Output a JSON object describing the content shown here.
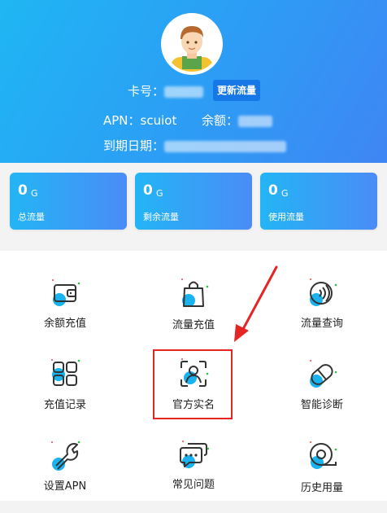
{
  "profile": {
    "card_label": "卡号：",
    "update_button": "更新流量",
    "apn_label": "APN：",
    "apn_value": "scuiot",
    "balance_label": "余额：",
    "expiry_label": "到期日期："
  },
  "stats": [
    {
      "value": "0",
      "unit": "G",
      "label": "总流量"
    },
    {
      "value": "0",
      "unit": "G",
      "label": "剩余流量"
    },
    {
      "value": "0",
      "unit": "G",
      "label": "使用流量"
    }
  ],
  "menu": [
    {
      "label": "余额充值",
      "icon": "wallet-icon"
    },
    {
      "label": "流量充值",
      "icon": "shopping-bag-icon"
    },
    {
      "label": "流量查询",
      "icon": "signal-search-icon"
    },
    {
      "label": "充值记录",
      "icon": "grid-icon"
    },
    {
      "label": "官方实名",
      "icon": "face-scan-icon"
    },
    {
      "label": "智能诊断",
      "icon": "pill-icon"
    },
    {
      "label": "设置APN",
      "icon": "wrench-icon"
    },
    {
      "label": "常见问题",
      "icon": "chat-icon"
    },
    {
      "label": "历史用量",
      "icon": "tape-icon"
    }
  ],
  "colors": {
    "header_gradient_start": "#1fb6f3",
    "header_gradient_end": "#3f86f3",
    "button": "#1677e6",
    "highlight": "#e52424",
    "icon_accent": "#1ab3ef"
  }
}
